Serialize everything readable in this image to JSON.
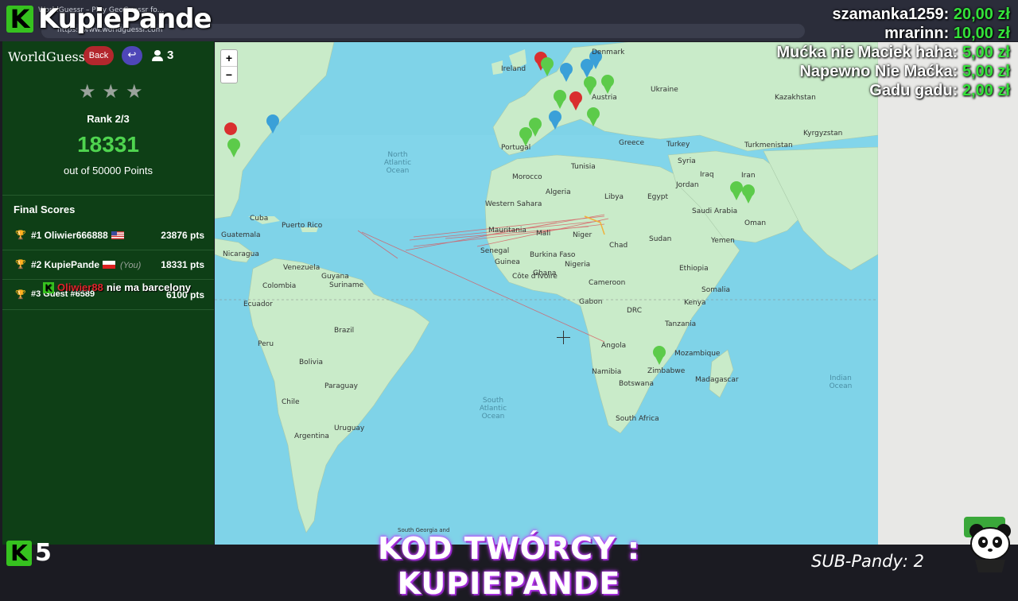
{
  "overlay": {
    "brand_letter": "K",
    "brand_name": "KupiePande",
    "bottom_letter": "K",
    "bottom_number": "5",
    "creator_code": "KOD TWÓRCY : KUPIEPANDE",
    "sub_pandy": "SUB-Pandy: 2",
    "chat": {
      "user": "Oliwier88",
      "message": "nie ma barcelony"
    }
  },
  "browser": {
    "tab_title": "WorldGuessr – Play GeoGuessr fo...",
    "url": "https://www.worldguessr.com"
  },
  "donations": [
    {
      "name": "szamanka1259:",
      "amount": "20,00 zł"
    },
    {
      "name": "mrarinn:",
      "amount": "10,00 zł"
    },
    {
      "name": "Mućka nie Maciek haha:",
      "amount": "5,00 zł"
    },
    {
      "name": "Napewno Nie Maćka:",
      "amount": "5,00 zł"
    },
    {
      "name": "Gadu gadu:",
      "amount": "2,00 zł"
    }
  ],
  "sidebar": {
    "title": "WorldGuessr",
    "back_label": "Back",
    "return_icon": "↩",
    "player_count": "3",
    "stars": [
      "★",
      "★",
      "★"
    ],
    "rank": "Rank 2/3",
    "score": "18331",
    "score_sub": "out of 50000 Points",
    "final_title": "Final Scores",
    "scores": [
      {
        "name": "#1 Oliwier666888",
        "pts": "23876 pts",
        "trophy": "🏆",
        "you": ""
      },
      {
        "name": "#2 KupiePande",
        "pts": "18331 pts",
        "trophy": "🏆",
        "you": "(You)"
      },
      {
        "name": "#3 Guest #6589",
        "pts": "6100 pts",
        "trophy": "🏆",
        "you": ""
      }
    ]
  },
  "map": {
    "zoom_in": "+",
    "zoom_out": "−",
    "countries": {
      "c1": "Ireland",
      "c2": "Denmark",
      "c3": "Austria",
      "c4": "Ukraine",
      "c5": "Kazakhstan",
      "c6": "Portugal",
      "c7": "Greece",
      "c8": "Turkey",
      "c9": "Turkmenistan",
      "c10": "Iran",
      "c11": "Morocco",
      "c12": "Tunisia",
      "c13": "Algeria",
      "c14": "Libya",
      "c15": "Egypt",
      "c16": "Iraq",
      "c17": "Syria",
      "c18": "Saudi Arabia",
      "c19": "Oman",
      "c20": "Yemen",
      "c21": "Western Sahara",
      "c22": "Mauritania",
      "c23": "Mali",
      "c24": "Niger",
      "c25": "Chad",
      "c26": "Sudan",
      "c27": "Senegal",
      "c28": "Guinea",
      "c29": "Nigeria",
      "c30": "Ethiopia",
      "c31": "Ghana",
      "c32": "Somalia",
      "c33": "Gabon",
      "c34": "DRC",
      "c35": "Kenya",
      "c36": "Tanzania",
      "c37": "Angola",
      "c38": "Mozambique",
      "c39": "Namibia",
      "c40": "Botswana",
      "c41": "Zimbabwe",
      "c42": "Madagascar",
      "c43": "South Africa",
      "c44": "Cuba",
      "c45": "Puerto Rico",
      "c46": "Nicaragua",
      "c47": "Venezuela",
      "c48": "Colombia",
      "c49": "Ecuador",
      "c50": "Guyana",
      "c51": "Suriname",
      "c52": "Peru",
      "c53": "Brazil",
      "c54": "Bolivia",
      "c55": "Paraguay",
      "c56": "Chile",
      "c57": "Argentina",
      "c58": "Uruguay",
      "c59": "Burkina Faso",
      "c60": "Côte d'Ivoire",
      "c61": "Cameroon",
      "c62": "Guatemala",
      "c63": "Kyrgyzstan",
      "c64": "Jordan"
    },
    "oceans": {
      "o1": "North Atlantic Ocean",
      "o2": "South Atlantic Ocean",
      "o3": "Indian Ocean"
    },
    "north_label": "South Georgia and"
  },
  "colors": {
    "sidebar_bg": "#0e3f16",
    "score_green": "#4fd44f",
    "back_red": "#b3272d",
    "return_purple": "#4e46b8",
    "ocean": "#7fd3e8",
    "land": "#c9ebc9",
    "pin_green": "#5ccb4a",
    "pin_red": "#d92f2f",
    "pin_blue": "#3aa0d8",
    "donation_amount": "#34e23a"
  }
}
